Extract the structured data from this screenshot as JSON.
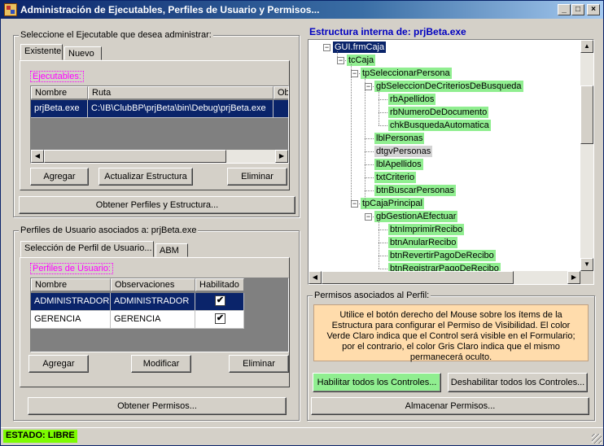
{
  "window": {
    "title": "Administración de Ejecutables, Perfiles de Usuario y Permisos...",
    "minimize": "_",
    "maximize": "□",
    "close": "×"
  },
  "ejecutable_group": {
    "legend": "Seleccione el Ejecutable que desea administrar:",
    "tabs": [
      "Existente",
      "Nuevo"
    ],
    "grid_label": "Ejecutables:",
    "columns": [
      "Nombre",
      "Ruta",
      "Ob"
    ],
    "rows": [
      {
        "nombre": "prjBeta.exe",
        "ruta": "C:\\IB\\ClubBP\\prjBeta\\bin\\Debug\\prjBeta.exe"
      }
    ],
    "buttons": {
      "agregar": "Agregar",
      "actualizar": "Actualizar Estructura",
      "eliminar": "Eliminar"
    },
    "obtener": "Obtener Perfiles y Estructura..."
  },
  "perfiles_group": {
    "legend": "Perfiles de Usuario asociados a: prjBeta.exe",
    "tabs": [
      "Selección de Perfil de Usuario...",
      "ABM"
    ],
    "grid_label": "Perfiles de Usuario:",
    "columns": [
      "Nombre",
      "Observaciones",
      "Habilitado"
    ],
    "rows": [
      {
        "nombre": "ADMINISTRADOR",
        "obs": "ADMINISTRADOR",
        "habilitado": "✔"
      },
      {
        "nombre": "GERENCIA",
        "obs": "GERENCIA",
        "habilitado": "✔"
      }
    ],
    "buttons": {
      "agregar": "Agregar",
      "modificar": "Modificar",
      "eliminar": "Eliminar"
    },
    "obtener": "Obtener Permisos..."
  },
  "estructura": {
    "heading": "Estructura interna de: prjBeta.exe",
    "nodes": [
      {
        "label": "GUI.frmCaja",
        "level": 0,
        "style": "root",
        "exp": "−"
      },
      {
        "label": "tcCaja",
        "level": 1,
        "style": "g",
        "exp": "−"
      },
      {
        "label": "tpSeleccionarPersona",
        "level": 2,
        "style": "g",
        "exp": "−"
      },
      {
        "label": "gbSeleccionDeCriteriosDeBusqueda",
        "level": 3,
        "style": "g",
        "exp": "−"
      },
      {
        "label": "rbApellidos",
        "level": 4,
        "style": "g"
      },
      {
        "label": "rbNumeroDeDocumento",
        "level": 4,
        "style": "g"
      },
      {
        "label": "chkBusquedaAutomatica",
        "level": 4,
        "style": "g"
      },
      {
        "label": "lblPersonas",
        "level": 3,
        "style": "g"
      },
      {
        "label": "dtgvPersonas",
        "level": 3,
        "style": "gray"
      },
      {
        "label": "lblApellidos",
        "level": 3,
        "style": "g"
      },
      {
        "label": "txtCriterio",
        "level": 3,
        "style": "g"
      },
      {
        "label": "btnBuscarPersonas",
        "level": 3,
        "style": "g"
      },
      {
        "label": "tpCajaPrincipal",
        "level": 2,
        "style": "g",
        "exp": "−"
      },
      {
        "label": "gbGestionAEfectuar",
        "level": 3,
        "style": "g",
        "exp": "−"
      },
      {
        "label": "btnImprimirRecibo",
        "level": 4,
        "style": "g"
      },
      {
        "label": "btnAnularRecibo",
        "level": 4,
        "style": "g"
      },
      {
        "label": "btnRevertirPagoDeRecibo",
        "level": 4,
        "style": "g"
      },
      {
        "label": "btnRegistrarPagoDeRecibo",
        "level": 4,
        "style": "g"
      }
    ]
  },
  "permisos": {
    "legend": "Permisos asociados al Perfil:",
    "info": "Utilice el botón derecho del Mouse sobre los ítems de la Estructura para configurar el Permiso de Visibilidad. El color Verde Claro indica que el Control será visible en el Formulario; por el contrario, el color Gris Claro indica que el mismo permanecerá oculto.",
    "habilitar": "Habilitar todos los Controles...",
    "deshabilitar": "Deshabilitar todos los Controles...",
    "almacenar": "Almacenar Permisos..."
  },
  "status": {
    "label": "ESTADO: LIBRE"
  },
  "colors": {
    "visible": "#90ee90",
    "hidden": "#d3d3d3",
    "selection": "#0a246a",
    "status": "#7cfc00"
  }
}
